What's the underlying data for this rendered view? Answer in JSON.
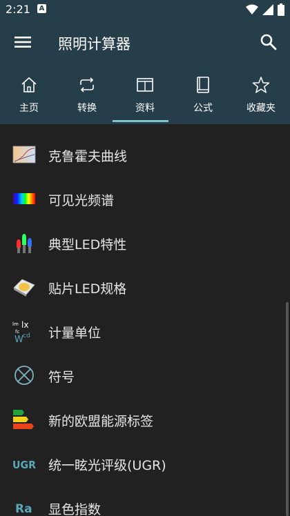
{
  "status_bar": {
    "time": "2:21",
    "notification_letter": "A"
  },
  "app_bar": {
    "title": "照明计算器"
  },
  "tabs": [
    {
      "label": "主页",
      "icon": "home-icon"
    },
    {
      "label": "转换",
      "icon": "convert-icon"
    },
    {
      "label": "资料",
      "icon": "book-open-icon",
      "selected": true
    },
    {
      "label": "公式",
      "icon": "book-icon"
    },
    {
      "label": "收藏夹",
      "icon": "star-icon"
    }
  ],
  "colors": {
    "app_bar": "#263e4a",
    "background": "#212121",
    "tab_indicator": "#7fc6c8",
    "accent_teal": "#5aa7b8"
  },
  "list": {
    "items": [
      {
        "label": "克鲁霍夫曲线",
        "icon": "kruithof-curve-icon"
      },
      {
        "label": "可见光频谱",
        "icon": "spectrum-icon"
      },
      {
        "label": "典型LED特性",
        "icon": "led-icon"
      },
      {
        "label": "贴片LED规格",
        "icon": "smd-led-icon"
      },
      {
        "label": "计量单位",
        "icon": "units-icon",
        "glyphs": {
          "a": "lm",
          "b": "lx",
          "c": "fc",
          "d": "W",
          "e": "cd"
        }
      },
      {
        "label": "符号",
        "icon": "circle-x-symbol-icon"
      },
      {
        "label": "新的欧盟能源标签",
        "icon": "energy-label-icon"
      },
      {
        "label": "统一眩光评级(UGR)",
        "icon": "ugr-icon",
        "glyph": "UGR"
      },
      {
        "label": "显色指数",
        "icon": "ra-icon",
        "glyph": "Ra"
      }
    ]
  }
}
